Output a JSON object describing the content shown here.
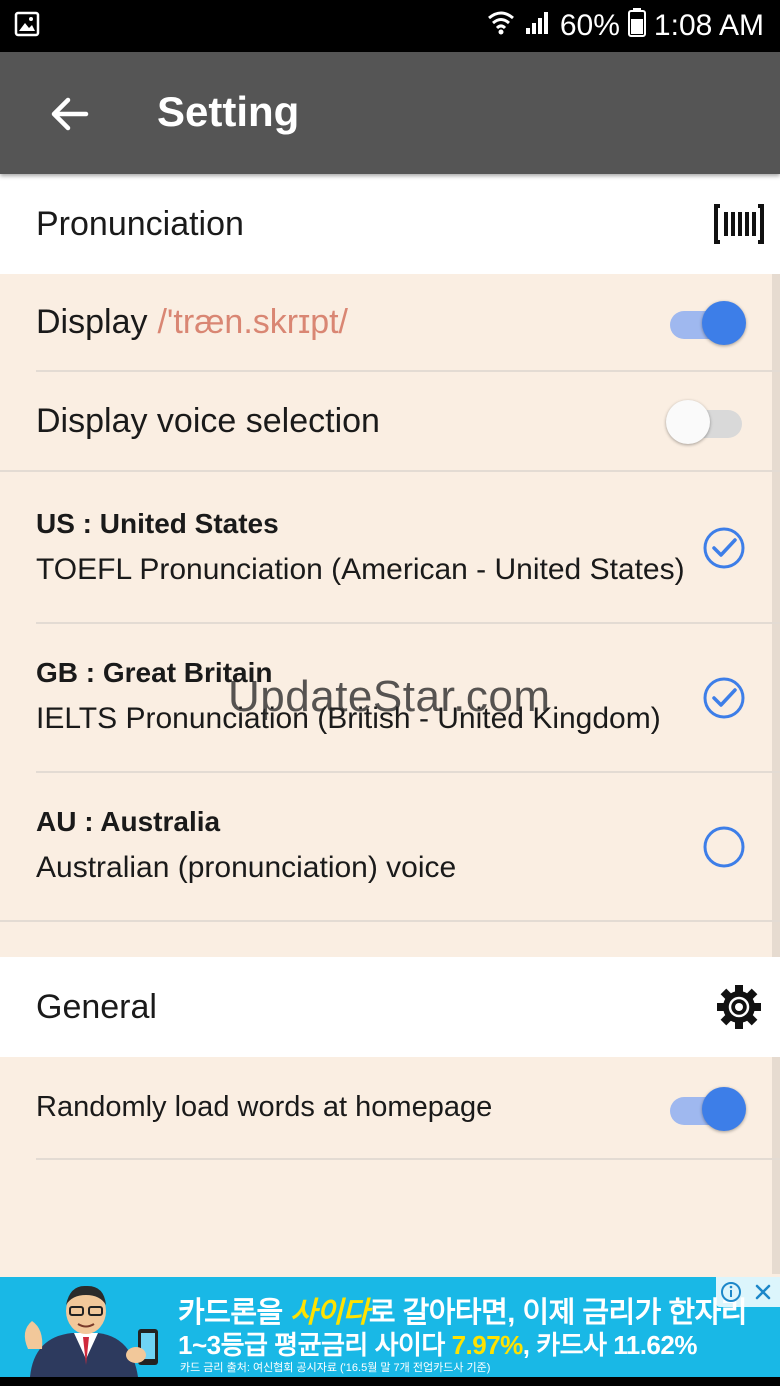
{
  "status_bar": {
    "battery_percent": "60%",
    "time": "1:08 AM"
  },
  "app_bar": {
    "title": "Setting"
  },
  "pronunciation": {
    "header": "Pronunciation",
    "display_label": "Display",
    "display_ipa": "/'træn.skrɪpt/",
    "display_on": true,
    "voice_selection_label": "Display voice selection",
    "voice_selection_on": false,
    "voices": [
      {
        "title": "US : United States",
        "subtitle": "TOEFL Pronunciation (American - United States)",
        "checked": true
      },
      {
        "title": "GB : Great Britain",
        "subtitle": "IELTS Pronunciation (British - United Kingdom)",
        "checked": true
      },
      {
        "title": "AU : Australia",
        "subtitle": "Australian (pronunciation) voice",
        "checked": false
      }
    ]
  },
  "general": {
    "header": "General",
    "random_load_label": "Randomly load words at homepage",
    "random_load_on": true
  },
  "watermark": "UpdateStar.com",
  "ad": {
    "line1_a": "카드론을 ",
    "line1_hl": "사이다",
    "line1_b": "로 갈아타면, 이제 금리가 한자리",
    "line2_a": "1~3등급 평균금리 사이다 ",
    "line2_hl": "7.97%",
    "line2_b": ", 카드사 11.62%",
    "line3": "카드 금리 출처: 여신협회 공시자료 ('16.5월 말 7개 전업카드사 기준)"
  },
  "colors": {
    "accent": "#3d7ee8",
    "app_bar": "#555555",
    "background": "#faeee2",
    "ipa": "#d98673",
    "ad_background": "#19b8e6"
  }
}
